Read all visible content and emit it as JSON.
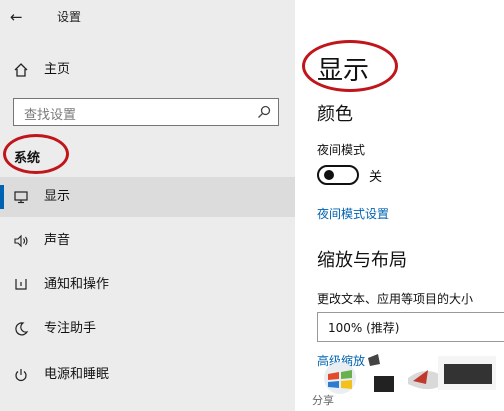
{
  "window": {
    "title": "设置"
  },
  "nav": {
    "home_label": "主页",
    "search_placeholder": "查找设置",
    "section_title": "系统",
    "items": [
      {
        "label": "显示",
        "icon": "display-icon",
        "active": true
      },
      {
        "label": "声音",
        "icon": "speaker-icon",
        "active": false
      },
      {
        "label": "通知和操作",
        "icon": "notification-icon",
        "active": false
      },
      {
        "label": "专注助手",
        "icon": "moon-icon",
        "active": false
      },
      {
        "label": "电源和睡眠",
        "icon": "power-icon",
        "active": false
      }
    ]
  },
  "content": {
    "page_title": "显示",
    "color_heading": "颜色",
    "night_mode_label": "夜间模式",
    "night_mode_state": "关",
    "night_mode_settings_link": "夜间模式设置",
    "scale_heading": "缩放与布局",
    "scale_label": "更改文本、应用等项目的大小",
    "scale_value": "100% (推荐)",
    "advanced_link": "高级缩放"
  },
  "watermark": {
    "text": "分享"
  },
  "colors": {
    "accent": "#0063b1",
    "annotation": "#c0151b",
    "nav_bg": "#ececec"
  }
}
